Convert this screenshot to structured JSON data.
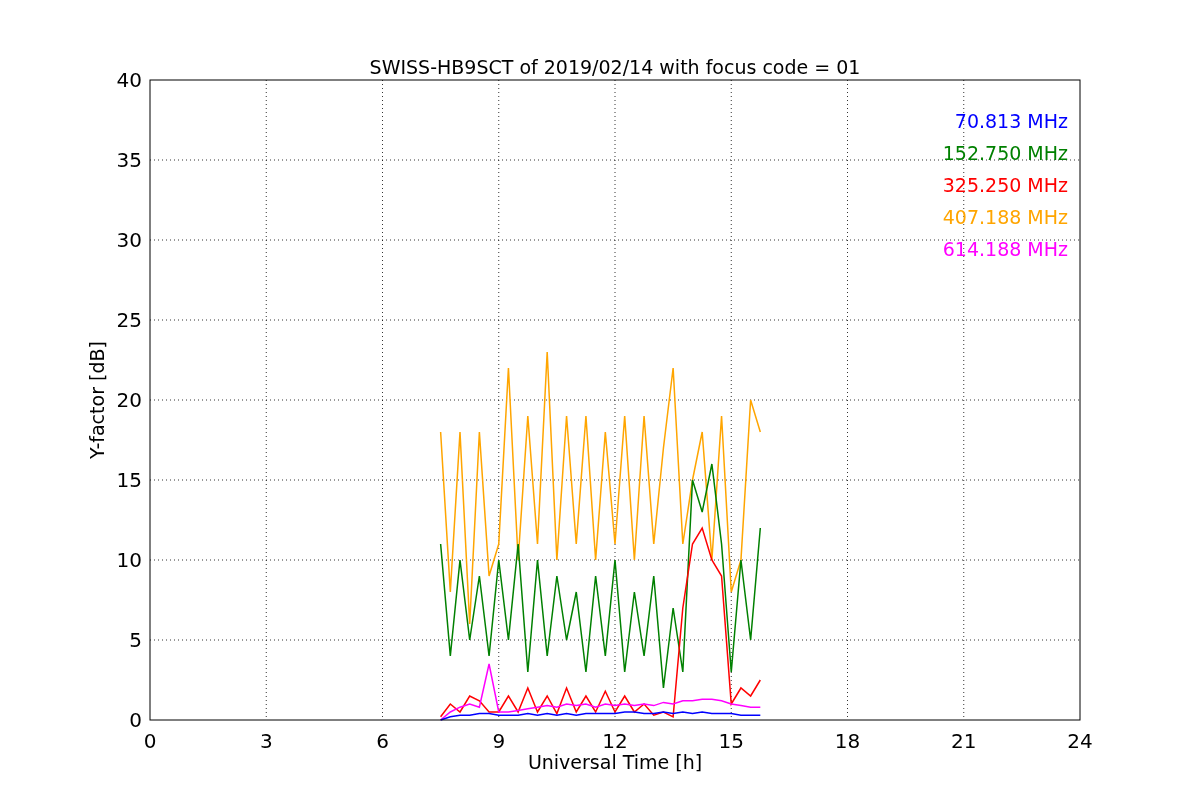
{
  "chart_data": {
    "type": "line",
    "title": "SWISS-HB9SCT of 2019/02/14 with focus code = 01",
    "xlabel": "Universal Time [h]",
    "ylabel": "Y-factor [dB]",
    "xlim": [
      0,
      24
    ],
    "ylim": [
      0,
      40
    ],
    "xticks": [
      0,
      3,
      6,
      9,
      12,
      15,
      18,
      21,
      24
    ],
    "yticks": [
      0,
      5,
      10,
      15,
      20,
      25,
      30,
      35,
      40
    ],
    "grid": true,
    "x": [
      7.5,
      7.75,
      8,
      8.25,
      8.5,
      8.75,
      9,
      9.25,
      9.5,
      9.75,
      10,
      10.25,
      10.5,
      10.75,
      11,
      11.25,
      11.5,
      11.75,
      12,
      12.25,
      12.5,
      12.75,
      13,
      13.25,
      13.5,
      13.75,
      14,
      14.25,
      14.5,
      14.75,
      15,
      15.25,
      15.5,
      15.75
    ],
    "series": [
      {
        "name": "70.813 MHz",
        "color": "#0000ff",
        "values": [
          0,
          0.2,
          0.3,
          0.3,
          0.4,
          0.4,
          0.3,
          0.3,
          0.3,
          0.4,
          0.3,
          0.4,
          0.3,
          0.4,
          0.3,
          0.4,
          0.4,
          0.4,
          0.4,
          0.5,
          0.5,
          0.4,
          0.4,
          0.5,
          0.4,
          0.5,
          0.4,
          0.5,
          0.4,
          0.4,
          0.4,
          0.3,
          0.3,
          0.3
        ]
      },
      {
        "name": "152.750 MHz",
        "color": "#008000",
        "values": [
          11,
          4,
          10,
          5,
          9,
          4,
          10,
          5,
          11,
          3,
          10,
          4,
          9,
          5,
          8,
          3,
          9,
          4,
          10,
          3,
          8,
          4,
          9,
          2,
          7,
          3,
          15,
          13,
          16,
          11,
          3,
          10,
          5,
          12
        ]
      },
      {
        "name": "325.250 MHz",
        "color": "#ff0000",
        "values": [
          0.2,
          1,
          0.5,
          1.5,
          1.2,
          0.5,
          0.5,
          1.5,
          0.5,
          2,
          0.5,
          1.5,
          0.4,
          2,
          0.5,
          1.5,
          0.5,
          1.8,
          0.5,
          1.5,
          0.5,
          1,
          0.3,
          0.5,
          0.2,
          7,
          11,
          12,
          10,
          9,
          1,
          2,
          1.5,
          2.5
        ]
      },
      {
        "name": "407.188 MHz",
        "color": "#ffa500",
        "values": [
          18,
          8,
          18,
          6,
          18,
          9,
          11,
          22,
          10,
          19,
          11,
          23,
          10,
          19,
          11,
          19,
          10,
          18,
          11,
          19,
          10,
          19,
          11,
          17,
          22,
          11,
          15,
          18,
          10,
          19,
          8,
          10,
          20,
          18
        ]
      },
      {
        "name": "614.188 MHz",
        "color": "#ff00ff",
        "values": [
          0,
          0.5,
          0.8,
          1,
          0.8,
          3.5,
          0.5,
          0.5,
          0.6,
          0.7,
          0.8,
          0.9,
          0.8,
          1,
          0.9,
          1,
          0.8,
          1,
          0.9,
          1,
          0.9,
          1,
          0.9,
          1.1,
          1,
          1.2,
          1.2,
          1.3,
          1.3,
          1.2,
          1,
          0.9,
          0.8,
          0.8
        ]
      }
    ]
  }
}
